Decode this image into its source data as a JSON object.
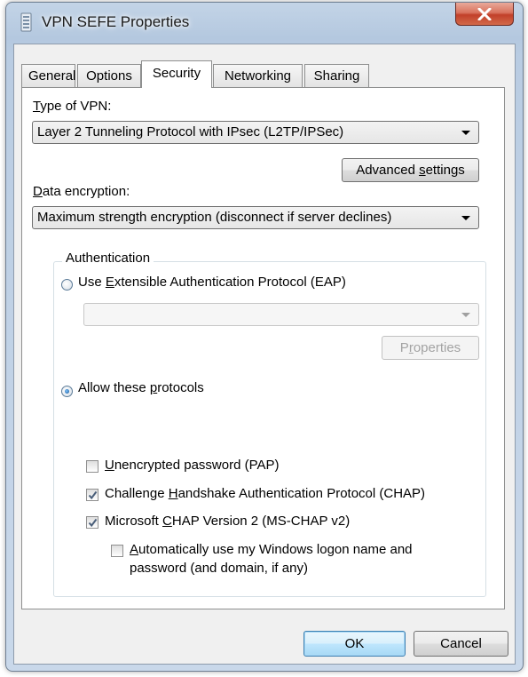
{
  "window": {
    "title": "VPN SEFE Properties",
    "close_glyph": "✕"
  },
  "tabs": [
    {
      "label": "General",
      "active": false
    },
    {
      "label": "Options",
      "active": false
    },
    {
      "label": "Security",
      "active": true
    },
    {
      "label": "Networking",
      "active": false
    },
    {
      "label": "Sharing",
      "active": false
    }
  ],
  "security": {
    "type_label": "Type of VPN:",
    "type_label_mnemonic": "T",
    "type_label_rest": "ype of VPN:",
    "vpn_type_value": "Layer 2 Tunneling Protocol with IPsec (L2TP/IPSec)",
    "advanced_button_pre": "Advanced ",
    "advanced_button_mnemonic": "s",
    "advanced_button_post": "ettings",
    "advanced_button": "Advanced settings",
    "encryption_label": "Data encryption:",
    "encryption_mnemonic": "D",
    "encryption_rest": "ata encryption:",
    "encryption_value": "Maximum strength encryption (disconnect if server declines)"
  },
  "authentication": {
    "legend": "Authentication",
    "eap_pre": "Use ",
    "eap_mnemonic": "E",
    "eap_post": "xtensible Authentication Protocol (EAP)",
    "eap_label": "Use Extensible Authentication Protocol (EAP)",
    "eap_selected": false,
    "eap_method_value": "",
    "properties_pre": "P",
    "properties_mnemonic": "r",
    "properties_post": "operties",
    "properties_button": "Properties",
    "allow_pre": "Allow these ",
    "allow_mnemonic": "p",
    "allow_post": "rotocols",
    "allow_label": "Allow these protocols",
    "allow_selected": true,
    "protocols": [
      {
        "pre": "",
        "mnemonic": "U",
        "post": "nencrypted password (PAP)",
        "label": "Unencrypted password (PAP)",
        "checked": false
      },
      {
        "pre": "Challenge ",
        "mnemonic": "H",
        "post": "andshake Authentication Protocol (CHAP)",
        "label": "Challenge Handshake Authentication Protocol (CHAP)",
        "checked": true
      },
      {
        "pre": "Microsoft ",
        "mnemonic": "C",
        "post": "HAP Version 2 (MS-CHAP v2)",
        "label": "Microsoft CHAP Version 2 (MS-CHAP v2)",
        "checked": true
      }
    ],
    "auto_logon": {
      "mnemonic": "A",
      "line1_rest": "utomatically use my Windows logon name and",
      "line2": "password (and domain, if any)",
      "checked": false
    }
  },
  "footer": {
    "ok_label": "OK",
    "cancel_label": "Cancel"
  },
  "colors": {
    "checkmark": "#4a5f7a",
    "radio_dot": "#0f4f8f"
  }
}
